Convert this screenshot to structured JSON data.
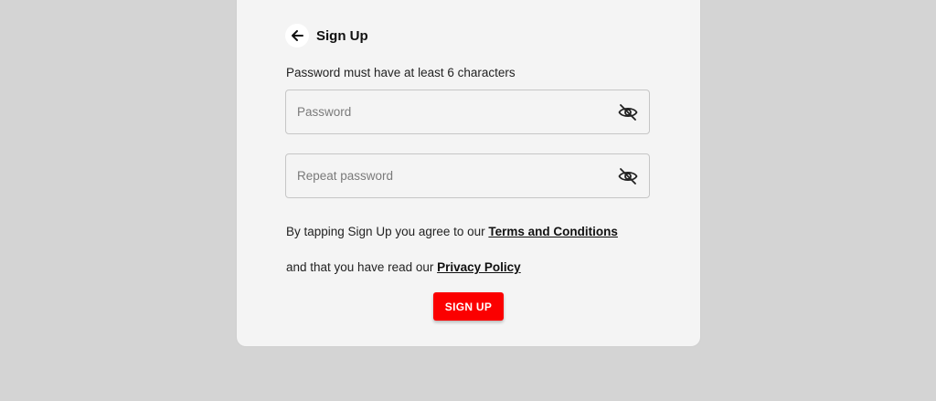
{
  "header": {
    "title": "Sign Up",
    "back_icon": "arrow-left-icon"
  },
  "hint": "Password must have at least 6 characters",
  "fields": {
    "password": {
      "placeholder": "Password",
      "value": "",
      "icon": "eye-off-icon"
    },
    "repeat_password": {
      "placeholder": "Repeat password",
      "value": "",
      "icon": "eye-off-icon"
    }
  },
  "legal": {
    "line1_prefix": "By tapping Sign Up you agree to our ",
    "terms_link": "Terms and Conditions",
    "line2_prefix": "and that you have read our ",
    "privacy_link": "Privacy Policy"
  },
  "actions": {
    "signup_label": "SIGN UP"
  },
  "colors": {
    "background": "#d4d4d4",
    "card": "#f4f4f4",
    "accent": "#fb0000"
  }
}
